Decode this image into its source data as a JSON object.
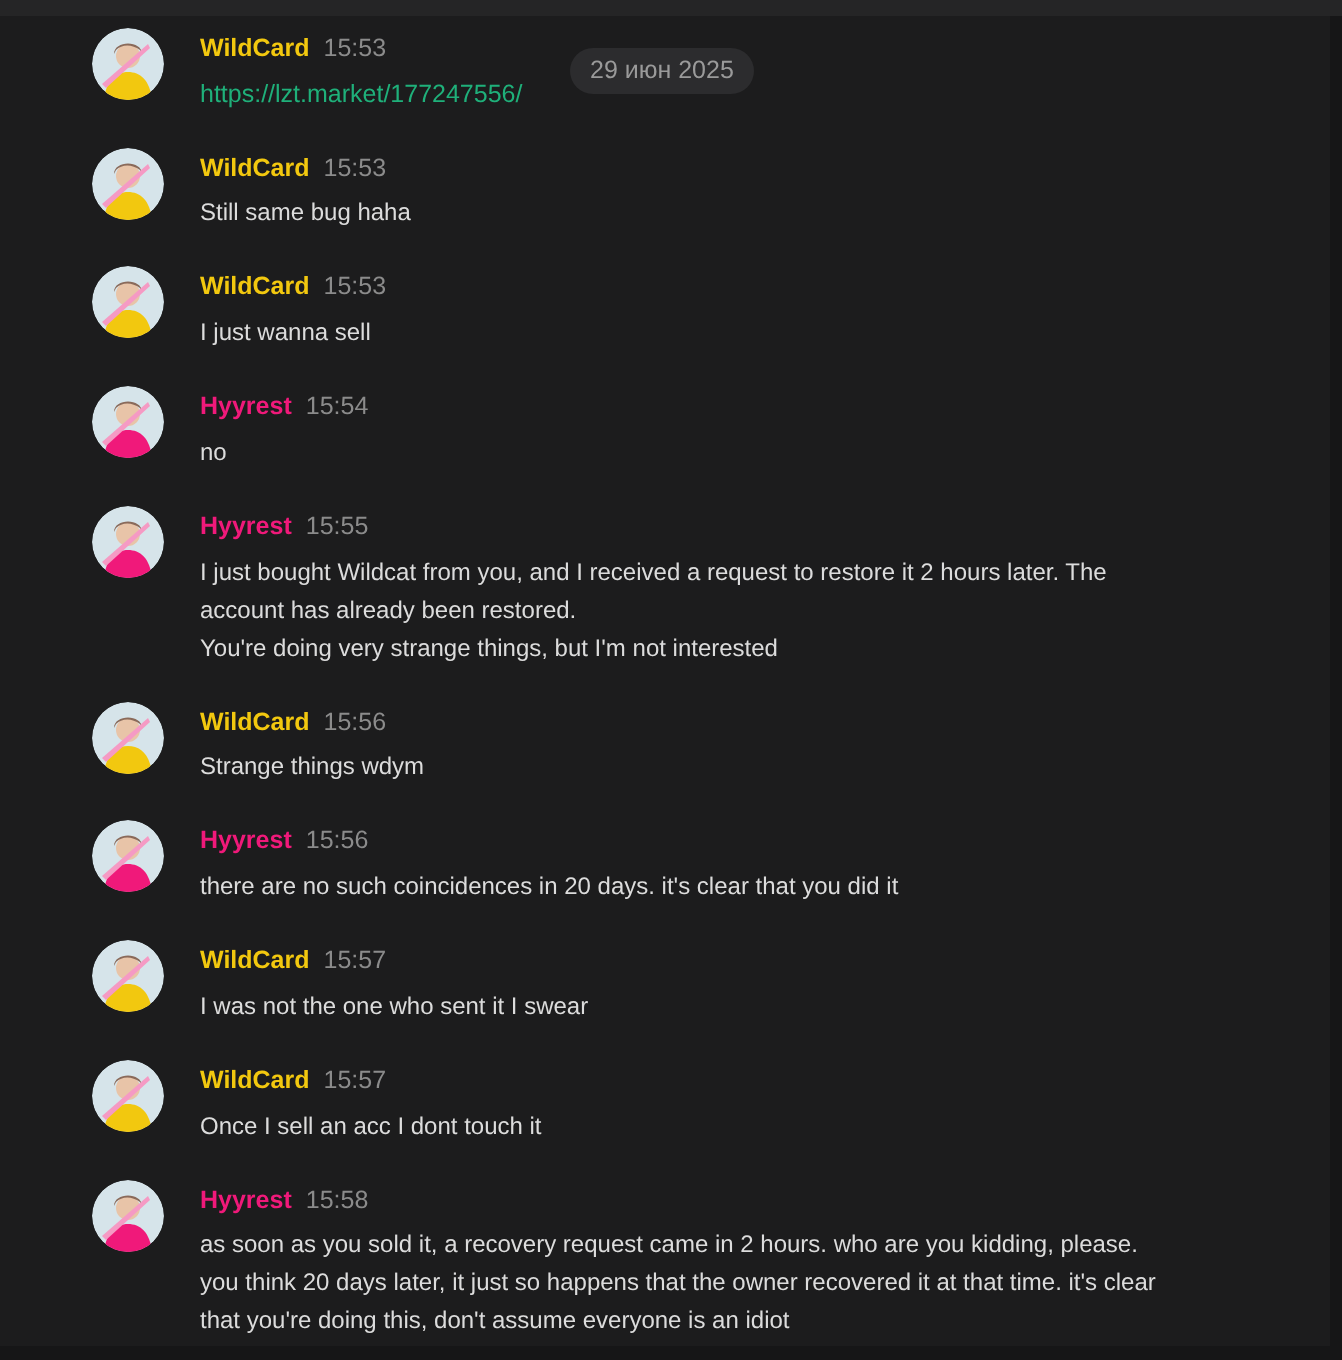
{
  "date_badge": "29 июн 2025",
  "messages": [
    {
      "author": "WildCard",
      "color": "#f2c80f",
      "time": "15:53",
      "kind": "link",
      "text": "https://lzt.market/177247556/"
    },
    {
      "author": "WildCard",
      "color": "#f2c80f",
      "time": "15:53",
      "kind": "text",
      "text": "Still same bug haha"
    },
    {
      "author": "WildCard",
      "color": "#f2c80f",
      "time": "15:53",
      "kind": "text",
      "text": "I just wanna sell"
    },
    {
      "author": "Hyyrest",
      "color": "#f0197a",
      "time": "15:54",
      "kind": "text",
      "text": "no"
    },
    {
      "author": "Hyyrest",
      "color": "#f0197a",
      "time": "15:55",
      "kind": "text",
      "text": "I just bought Wildcat from you, and I received a request to restore it 2 hours later. The account has already been restored.\nYou're doing very strange things, but I'm not interested"
    },
    {
      "author": "WildCard",
      "color": "#f2c80f",
      "time": "15:56",
      "kind": "text",
      "text": "Strange things wdym"
    },
    {
      "author": "Hyyrest",
      "color": "#f0197a",
      "time": "15:56",
      "kind": "text",
      "text": "there are no such coincidences in 20 days. it's clear that you did it"
    },
    {
      "author": "WildCard",
      "color": "#f2c80f",
      "time": "15:57",
      "kind": "text",
      "text": "I was not the one who sent it I swear"
    },
    {
      "author": "WildCard",
      "color": "#f2c80f",
      "time": "15:57",
      "kind": "text",
      "text": "Once I sell an acc I dont touch it"
    },
    {
      "author": "Hyyrest",
      "color": "#f0197a",
      "time": "15:58",
      "kind": "text",
      "text": "as soon as you sold it, a recovery request came in 2 hours. who are you kidding, please. you think 20 days later, it just so happens that the owner recovered it at that time. it's clear that you're doing this, don't assume everyone is an idiot"
    }
  ]
}
